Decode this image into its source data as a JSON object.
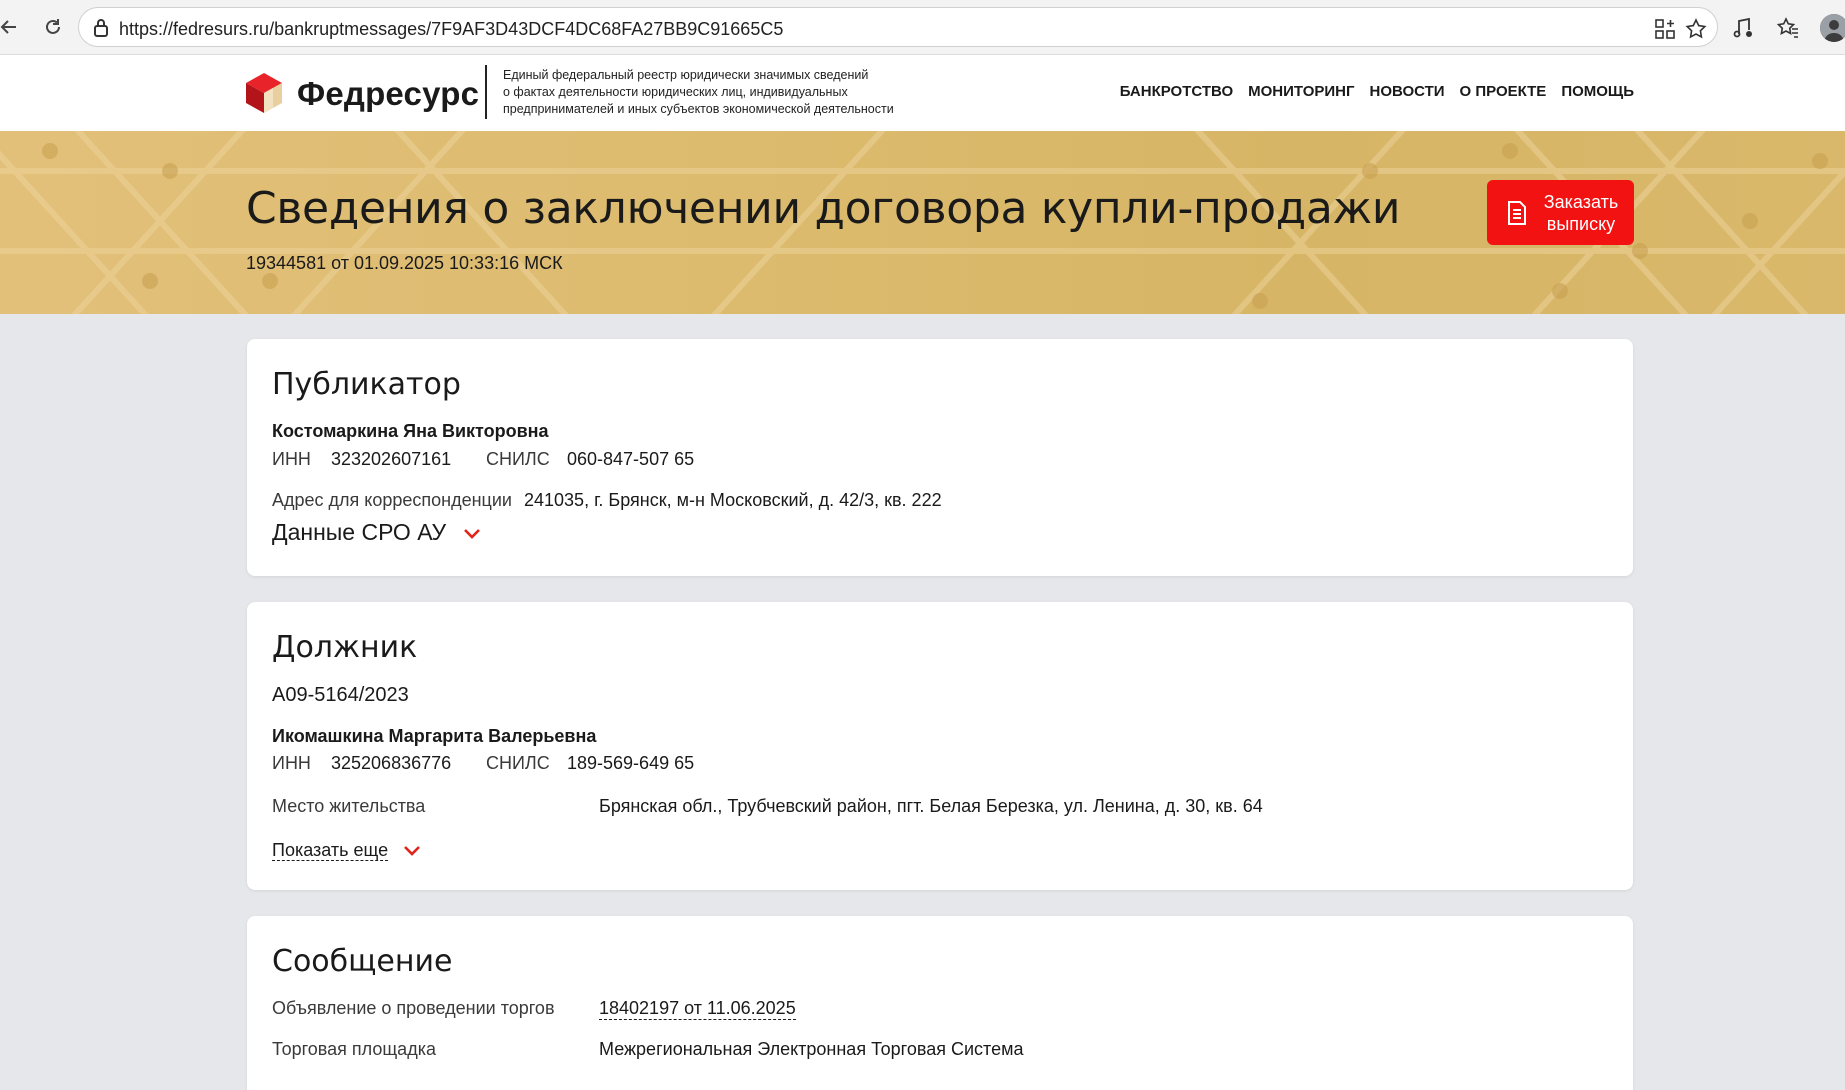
{
  "browser": {
    "url": "https://fedresurs.ru/bankruptmessages/7F9AF3D43DCF4DC68FA27BB9C91665C5"
  },
  "header": {
    "brand": "Федресурс",
    "tagline": [
      "Единый федеральный реестр юридически значимых сведений",
      "о фактах деятельности юридических лиц, индивидуальных",
      "предпринимателей и иных субъектов экономической деятельности"
    ],
    "nav": [
      "БАНКРОТСТВО",
      "МОНИТОРИНГ",
      "НОВОСТИ",
      "О ПРОЕКТЕ",
      "ПОМОЩЬ"
    ]
  },
  "hero": {
    "title": "Сведения о заключении договора купли-продажи",
    "subtitle": "19344581 от 01.09.2025 10:33:16 МСК",
    "order_button": "Заказать выписку"
  },
  "publisher": {
    "heading": "Публикатор",
    "name": "Костомаркина Яна Викторовна",
    "inn_label": "ИНН",
    "inn": "323202607161",
    "snils_label": "СНИЛС",
    "snils": "060-847-507 65",
    "address_label": "Адрес для корреспонденции",
    "address": "241035, г. Брянск, м-н Московский, д. 42/3, кв. 222",
    "sro_toggle": "Данные СРО АУ"
  },
  "debtor": {
    "heading": "Должник",
    "case_number": "А09-5164/2023",
    "name": "Икомашкина Маргарита Валерьевна",
    "inn_label": "ИНН",
    "inn": "325206836776",
    "snils_label": "СНИЛС",
    "snils": "189-569-649 65",
    "residence_label": "Место жительства",
    "residence": "Брянская обл., Трубчевский район, пгт. Белая Березка, ул. Ленина, д. 30, кв. 64",
    "show_more": "Показать еще"
  },
  "message": {
    "heading": "Сообщение",
    "auction_label": "Объявление о проведении торгов",
    "auction_link": "18402197 от 11.06.2025",
    "platform_label": "Торговая площадка",
    "platform": "Межрегиональная Электронная Торговая Система"
  },
  "colors": {
    "accent_red": "#f21212",
    "hero_gold": "#dcbb6e",
    "page_bg": "#e6e7ea"
  }
}
